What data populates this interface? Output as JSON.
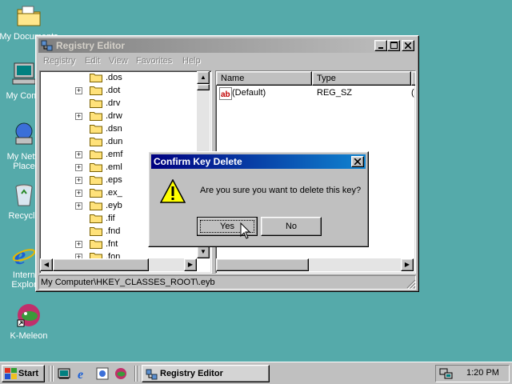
{
  "desktop": {
    "icons": [
      {
        "name": "my-documents",
        "label": "My Documents",
        "icon": "folder-documents-icon"
      },
      {
        "name": "my-computer",
        "label": "My Com",
        "icon": "computer-icon"
      },
      {
        "name": "my-network",
        "label_line1": "My Netw",
        "label_line2": "Place",
        "icon": "network-icon"
      },
      {
        "name": "recycle-bin",
        "label": "Recycle",
        "icon": "recycle-bin-icon"
      },
      {
        "name": "internet",
        "label_line1": "Intern",
        "label_line2": "Explor",
        "icon": "internet-explorer-icon"
      },
      {
        "name": "k-meleon",
        "label": "K-Meleon",
        "icon": "k-meleon-icon"
      }
    ]
  },
  "registry": {
    "title": "Registry Editor",
    "menu": [
      "Registry",
      "Edit",
      "View",
      "Favorites",
      "Help"
    ],
    "tree": [
      {
        "label": ".dos",
        "expandable": false
      },
      {
        "label": ".dot",
        "expandable": true
      },
      {
        "label": ".drv",
        "expandable": false
      },
      {
        "label": ".drw",
        "expandable": true
      },
      {
        "label": ".dsn",
        "expandable": false
      },
      {
        "label": ".dun",
        "expandable": false
      },
      {
        "label": ".emf",
        "expandable": true
      },
      {
        "label": ".eml",
        "expandable": true
      },
      {
        "label": ".eps",
        "expandable": true
      },
      {
        "label": ".ex_",
        "expandable": true
      },
      {
        "label": ".eyb",
        "expandable": true,
        "selected": true
      },
      {
        "label": ".fif",
        "expandable": false
      },
      {
        "label": ".fnd",
        "expandable": false
      },
      {
        "label": ".fnt",
        "expandable": true
      },
      {
        "label": ".fon",
        "expandable": true
      }
    ],
    "columns": [
      "Name",
      "Type",
      "D"
    ],
    "values": [
      {
        "name": "(Default)",
        "type": "REG_SZ",
        "data": "("
      }
    ],
    "status": "My Computer\\HKEY_CLASSES_ROOT\\.eyb"
  },
  "dialog": {
    "title": "Confirm Key Delete",
    "message": "Are you sure you want to delete this key?",
    "yes_label": "Yes",
    "no_label": "No",
    "close_label": "×",
    "icon": "warning-icon"
  },
  "taskbar": {
    "start_label": "Start",
    "quick_launch": [
      "show-desktop-icon",
      "internet-explorer-icon",
      "channels-icon",
      "k-meleon-icon"
    ],
    "task_label": "Registry Editor",
    "clock": "1:20 PM"
  },
  "colors": {
    "desktop": "#55aaaa",
    "title_active": "#000080",
    "title_inactive": "#808080",
    "face": "#c0c0c0"
  }
}
